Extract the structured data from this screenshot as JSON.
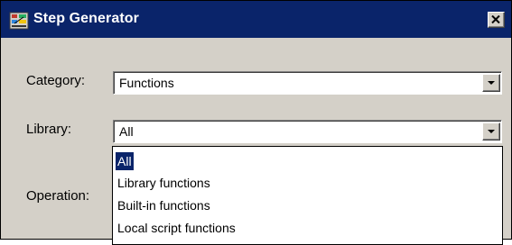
{
  "window": {
    "title": "Step Generator",
    "close_icon": "close-icon",
    "app_icon": "step-generator-app-icon"
  },
  "form": {
    "category_label": "Category:",
    "category_value": "Functions",
    "library_label": "Library:",
    "library_value": "All",
    "operation_label": "Operation:"
  },
  "library_dropdown": {
    "options": [
      "All",
      "Library functions",
      "Built-in functions",
      "Local script functions"
    ],
    "selected_index": 0
  },
  "colors": {
    "titlebar": "#0a246a",
    "dialog_bg": "#d4d0c8",
    "selection": "#0a246a"
  }
}
